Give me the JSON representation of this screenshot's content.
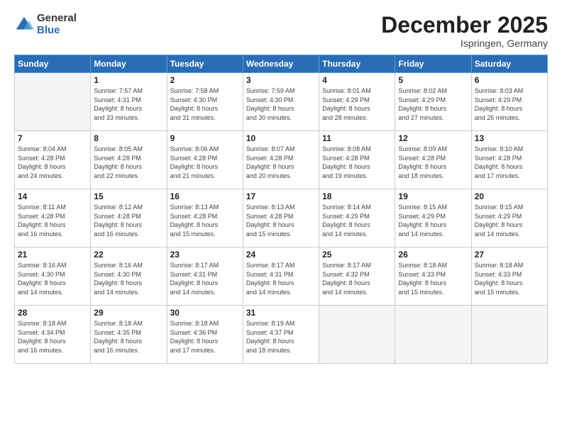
{
  "logo": {
    "general": "General",
    "blue": "Blue"
  },
  "header": {
    "title": "December 2025",
    "subtitle": "Ispringen, Germany"
  },
  "weekdays": [
    "Sunday",
    "Monday",
    "Tuesday",
    "Wednesday",
    "Thursday",
    "Friday",
    "Saturday"
  ],
  "weeks": [
    [
      {
        "day": "",
        "info": ""
      },
      {
        "day": "1",
        "info": "Sunrise: 7:57 AM\nSunset: 4:31 PM\nDaylight: 8 hours\nand 33 minutes."
      },
      {
        "day": "2",
        "info": "Sunrise: 7:58 AM\nSunset: 4:30 PM\nDaylight: 8 hours\nand 31 minutes."
      },
      {
        "day": "3",
        "info": "Sunrise: 7:59 AM\nSunset: 4:30 PM\nDaylight: 8 hours\nand 30 minutes."
      },
      {
        "day": "4",
        "info": "Sunrise: 8:01 AM\nSunset: 4:29 PM\nDaylight: 8 hours\nand 28 minutes."
      },
      {
        "day": "5",
        "info": "Sunrise: 8:02 AM\nSunset: 4:29 PM\nDaylight: 8 hours\nand 27 minutes."
      },
      {
        "day": "6",
        "info": "Sunrise: 8:03 AM\nSunset: 4:29 PM\nDaylight: 8 hours\nand 25 minutes."
      }
    ],
    [
      {
        "day": "7",
        "info": "Sunrise: 8:04 AM\nSunset: 4:28 PM\nDaylight: 8 hours\nand 24 minutes."
      },
      {
        "day": "8",
        "info": "Sunrise: 8:05 AM\nSunset: 4:28 PM\nDaylight: 8 hours\nand 22 minutes."
      },
      {
        "day": "9",
        "info": "Sunrise: 8:06 AM\nSunset: 4:28 PM\nDaylight: 8 hours\nand 21 minutes."
      },
      {
        "day": "10",
        "info": "Sunrise: 8:07 AM\nSunset: 4:28 PM\nDaylight: 8 hours\nand 20 minutes."
      },
      {
        "day": "11",
        "info": "Sunrise: 8:08 AM\nSunset: 4:28 PM\nDaylight: 8 hours\nand 19 minutes."
      },
      {
        "day": "12",
        "info": "Sunrise: 8:09 AM\nSunset: 4:28 PM\nDaylight: 8 hours\nand 18 minutes."
      },
      {
        "day": "13",
        "info": "Sunrise: 8:10 AM\nSunset: 4:28 PM\nDaylight: 8 hours\nand 17 minutes."
      }
    ],
    [
      {
        "day": "14",
        "info": "Sunrise: 8:11 AM\nSunset: 4:28 PM\nDaylight: 8 hours\nand 16 minutes."
      },
      {
        "day": "15",
        "info": "Sunrise: 8:12 AM\nSunset: 4:28 PM\nDaylight: 8 hours\nand 16 minutes."
      },
      {
        "day": "16",
        "info": "Sunrise: 8:13 AM\nSunset: 4:28 PM\nDaylight: 8 hours\nand 15 minutes."
      },
      {
        "day": "17",
        "info": "Sunrise: 8:13 AM\nSunset: 4:28 PM\nDaylight: 8 hours\nand 15 minutes."
      },
      {
        "day": "18",
        "info": "Sunrise: 8:14 AM\nSunset: 4:29 PM\nDaylight: 8 hours\nand 14 minutes."
      },
      {
        "day": "19",
        "info": "Sunrise: 8:15 AM\nSunset: 4:29 PM\nDaylight: 8 hours\nand 14 minutes."
      },
      {
        "day": "20",
        "info": "Sunrise: 8:15 AM\nSunset: 4:29 PM\nDaylight: 8 hours\nand 14 minutes."
      }
    ],
    [
      {
        "day": "21",
        "info": "Sunrise: 8:16 AM\nSunset: 4:30 PM\nDaylight: 8 hours\nand 14 minutes."
      },
      {
        "day": "22",
        "info": "Sunrise: 8:16 AM\nSunset: 4:30 PM\nDaylight: 8 hours\nand 14 minutes."
      },
      {
        "day": "23",
        "info": "Sunrise: 8:17 AM\nSunset: 4:31 PM\nDaylight: 8 hours\nand 14 minutes."
      },
      {
        "day": "24",
        "info": "Sunrise: 8:17 AM\nSunset: 4:31 PM\nDaylight: 8 hours\nand 14 minutes."
      },
      {
        "day": "25",
        "info": "Sunrise: 8:17 AM\nSunset: 4:32 PM\nDaylight: 8 hours\nand 14 minutes."
      },
      {
        "day": "26",
        "info": "Sunrise: 8:18 AM\nSunset: 4:33 PM\nDaylight: 8 hours\nand 15 minutes."
      },
      {
        "day": "27",
        "info": "Sunrise: 8:18 AM\nSunset: 4:33 PM\nDaylight: 8 hours\nand 15 minutes."
      }
    ],
    [
      {
        "day": "28",
        "info": "Sunrise: 8:18 AM\nSunset: 4:34 PM\nDaylight: 8 hours\nand 16 minutes."
      },
      {
        "day": "29",
        "info": "Sunrise: 8:18 AM\nSunset: 4:35 PM\nDaylight: 8 hours\nand 16 minutes."
      },
      {
        "day": "30",
        "info": "Sunrise: 8:18 AM\nSunset: 4:36 PM\nDaylight: 8 hours\nand 17 minutes."
      },
      {
        "day": "31",
        "info": "Sunrise: 8:19 AM\nSunset: 4:37 PM\nDaylight: 8 hours\nand 18 minutes."
      },
      {
        "day": "",
        "info": ""
      },
      {
        "day": "",
        "info": ""
      },
      {
        "day": "",
        "info": ""
      }
    ]
  ]
}
